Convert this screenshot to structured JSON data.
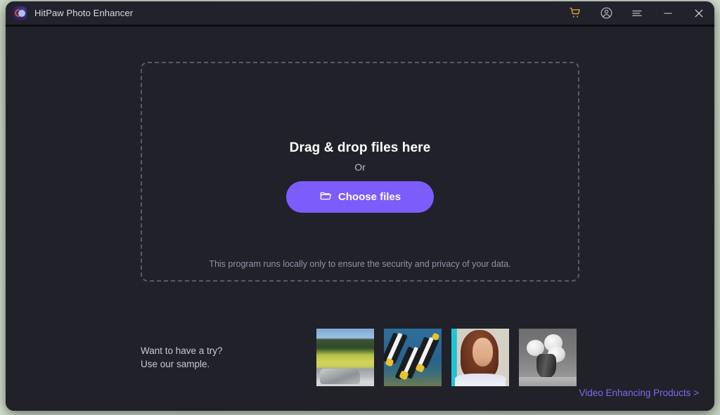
{
  "window": {
    "title": "HitPaw Photo Enhancer",
    "logo_icon": "hitpaw-logo-icon"
  },
  "titlebar": {
    "buttons": [
      {
        "name": "cart-icon",
        "label": "Shopping cart"
      },
      {
        "name": "account-icon",
        "label": "Account"
      },
      {
        "name": "menu-icon",
        "label": "Menu"
      },
      {
        "name": "minimize-icon",
        "label": "Minimize"
      },
      {
        "name": "close-icon",
        "label": "Close"
      }
    ],
    "colors": {
      "cart": "#e0a42a",
      "icon": "#b9bcc8"
    }
  },
  "dropzone": {
    "title": "Drag & drop files here",
    "or": "Or",
    "choose_button": "Choose files",
    "folder_icon": "folder-icon",
    "privacy": "This program runs locally only to ensure the security and privacy of your data."
  },
  "samples": {
    "prompt_line1": "Want to have a try?",
    "prompt_line2": "Use our sample.",
    "thumbnails": [
      {
        "name": "sample-thumbnail-landscape",
        "alt": "Mountain meadow landscape with rocks"
      },
      {
        "name": "sample-thumbnail-fish",
        "alt": "Striped bannerfish underwater"
      },
      {
        "name": "sample-thumbnail-portrait",
        "alt": "Portrait of a woman with auburn hair"
      },
      {
        "name": "sample-thumbnail-roses",
        "alt": "Black and white roses in a vase"
      }
    ]
  },
  "footer": {
    "link": "Video Enhancing Products >"
  },
  "colors": {
    "accent": "#7c5cfa",
    "titlebar_bg": "#22222c",
    "body_bg": "#212129",
    "link": "#7a6cf0",
    "dashed_border": "#565a6e"
  }
}
